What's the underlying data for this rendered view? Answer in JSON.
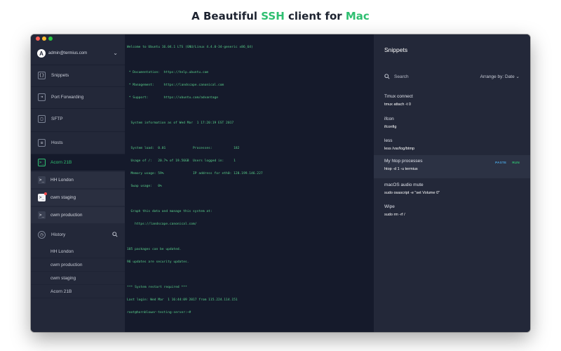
{
  "headline": {
    "prefix": "A Beautiful ",
    "ssh": "SSH",
    "middle": " client for ",
    "mac": "Mac"
  },
  "colors": {
    "accent_green": "#2fbf71",
    "accent_blue": "#4aa3df",
    "close": "#ff5f57",
    "minimize": "#febc2e",
    "zoom": "#28c840"
  },
  "sidebar": {
    "account": {
      "avatar_letter": "A",
      "email": "admin@termius.com"
    },
    "nav": [
      {
        "label": "Snippets",
        "icon": "code-braces-icon"
      },
      {
        "label": "Port Forwarding",
        "icon": "arrow-right-icon"
      },
      {
        "label": "SFTP",
        "icon": "folder-icon"
      },
      {
        "label": "Hosts",
        "icon": "server-icon"
      }
    ],
    "hosts": [
      {
        "label": "Acorn 21B",
        "icon": "terminal-icon"
      },
      {
        "label": "HH London",
        "icon": "terminal-icon"
      },
      {
        "label": "cwm staging",
        "icon": "terminal-icon"
      },
      {
        "label": "cwm production",
        "icon": "terminal-icon"
      }
    ],
    "history": {
      "label": "History",
      "items": [
        "HH London",
        "cwm production",
        "cwm staging",
        "Acorn 21B"
      ]
    }
  },
  "terminal": {
    "lines": [
      "Welcome to Ubuntu 16.04.1 LTS (GNU/Linux 4.4.0-34-generic x86_64)",
      "",
      " * Documentation:  https://help.ubuntu.com",
      " * Management:     https://landscape.canonical.com",
      " * Support:        https://ubuntu.com/advantage",
      "",
      "  System information as of Wed Mar  1 17:20:19 EST 2017",
      "",
      "  System load:  0.01              Processes:           182",
      "  Usage of /:   20.7% of 19.56GB  Users logged in:     1",
      "  Memory usage: 59%               IP address for eth0: 128.199.146.227",
      "  Swap usage:   0%",
      "",
      "  Graph this data and manage this system at:",
      "    https://landscape.canonical.com/",
      "",
      "185 packages can be updated.",
      "96 updates are security updates.",
      "",
      "*** System restart required ***",
      "Last login: Wed Mar  1 16:44:09 2017 from 115.224.114.151",
      "root@hornblower-testing-server:~#"
    ]
  },
  "snippets": {
    "title": "Snippets",
    "search_label": "Search",
    "arrange_label": "Arrange by: Date",
    "paste_label": "PASTE",
    "run_label": "RUN",
    "items": [
      {
        "name": "Tmux connect",
        "command": "tmux attach -t 0"
      },
      {
        "name": "ifcon",
        "command": "ifconfig"
      },
      {
        "name": "less",
        "command": "less /var/log/btmp"
      },
      {
        "name": "My htop processes",
        "command": "htop -d 1 -u termius"
      },
      {
        "name": "macOS audio mute",
        "command": "sudo osascript -e \"set Volume 0\""
      },
      {
        "name": "Wipe",
        "command": "sudo rm -rf /"
      }
    ]
  }
}
